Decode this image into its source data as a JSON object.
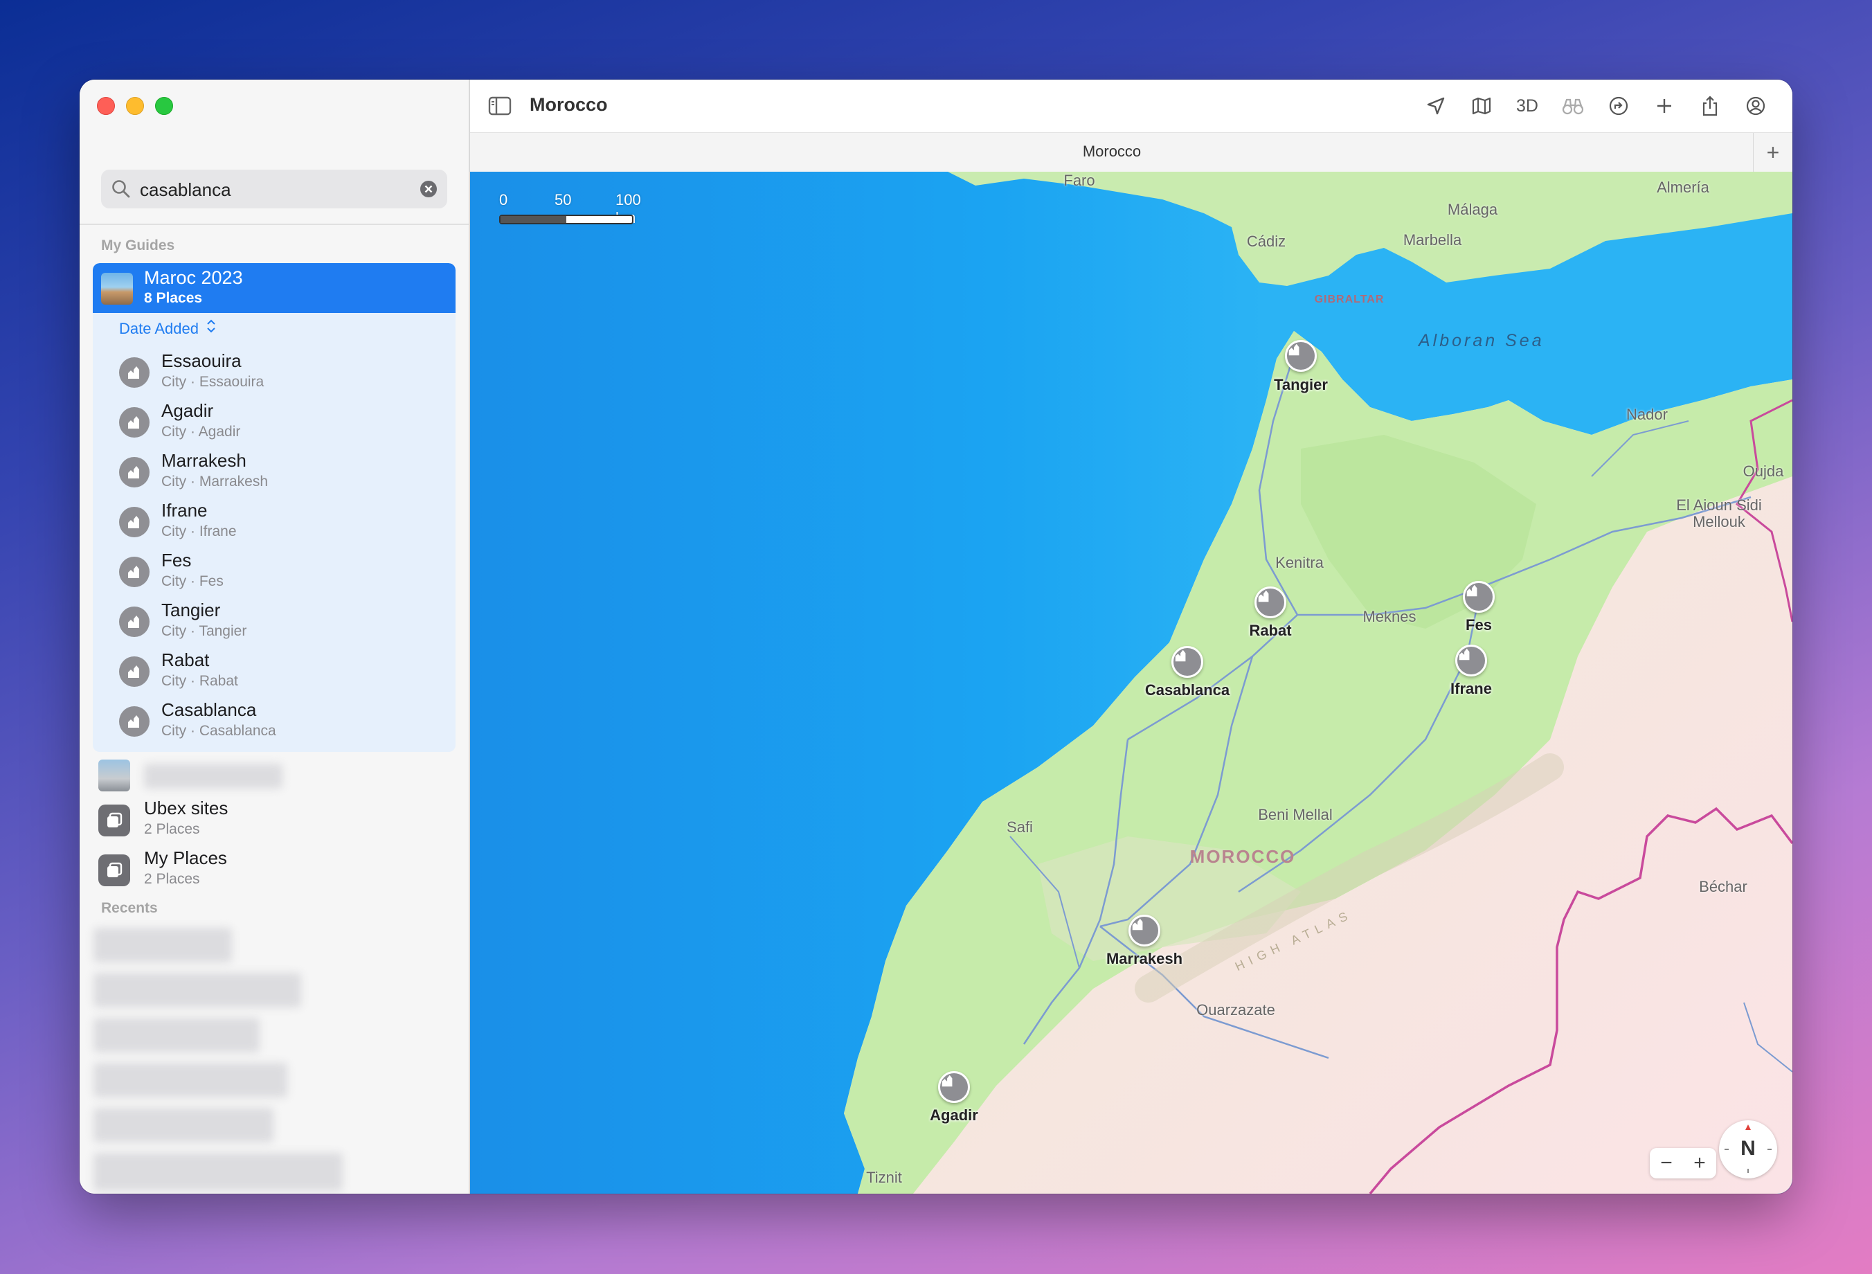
{
  "window": {
    "title": "Morocco",
    "tab_title": "Morocco"
  },
  "search": {
    "value": "casablanca"
  },
  "sidebar": {
    "my_guides_header": "My Guides",
    "recents_header": "Recents",
    "selected_guide": {
      "title": "Maroc 2023",
      "subtitle": "8 Places"
    },
    "sort_label": "Date Added",
    "places": [
      {
        "name": "Essaouira",
        "detail": "City · Essaouira"
      },
      {
        "name": "Agadir",
        "detail": "City · Agadir"
      },
      {
        "name": "Marrakesh",
        "detail": "City · Marrakesh"
      },
      {
        "name": "Ifrane",
        "detail": "City · Ifrane"
      },
      {
        "name": "Fes",
        "detail": "City · Fes"
      },
      {
        "name": "Tangier",
        "detail": "City · Tangier"
      },
      {
        "name": "Rabat",
        "detail": "City · Rabat"
      },
      {
        "name": "Casablanca",
        "detail": "City · Casablanca"
      }
    ],
    "other_guides": [
      {
        "name": "Ubex sites",
        "detail": "2 Places"
      },
      {
        "name": "My Places",
        "detail": "2 Places"
      }
    ]
  },
  "toolbar": {
    "three_d_label": "3D"
  },
  "map": {
    "scale": {
      "labels": [
        "0",
        "50",
        "100 km"
      ]
    },
    "cities": [
      "Tangier",
      "Rabat",
      "Fes",
      "Casablanca",
      "Ifrane",
      "Marrakesh",
      "Agadir"
    ],
    "towns": [
      "Faro",
      "Almería",
      "Málaga",
      "Cádiz",
      "Marbella",
      "Nador",
      "Oujda",
      "El Aioun Sidi Mellouk",
      "Kenitra",
      "Meknes",
      "Safi",
      "Beni Mellal",
      "Béchar",
      "Ouarzazate",
      "Tiznit"
    ],
    "sea": "Alboran Sea",
    "country": "MOROCCO",
    "gibraltar": "GIBRALTAR",
    "high_atlas": "HIGH ATLAS",
    "compass": "N"
  },
  "colors": {
    "accent": "#1f7cf1",
    "sea": "#1aa6f2",
    "land_green": "#c8ecaa",
    "desert": "#f4ead9",
    "border": "#c94a9c"
  }
}
